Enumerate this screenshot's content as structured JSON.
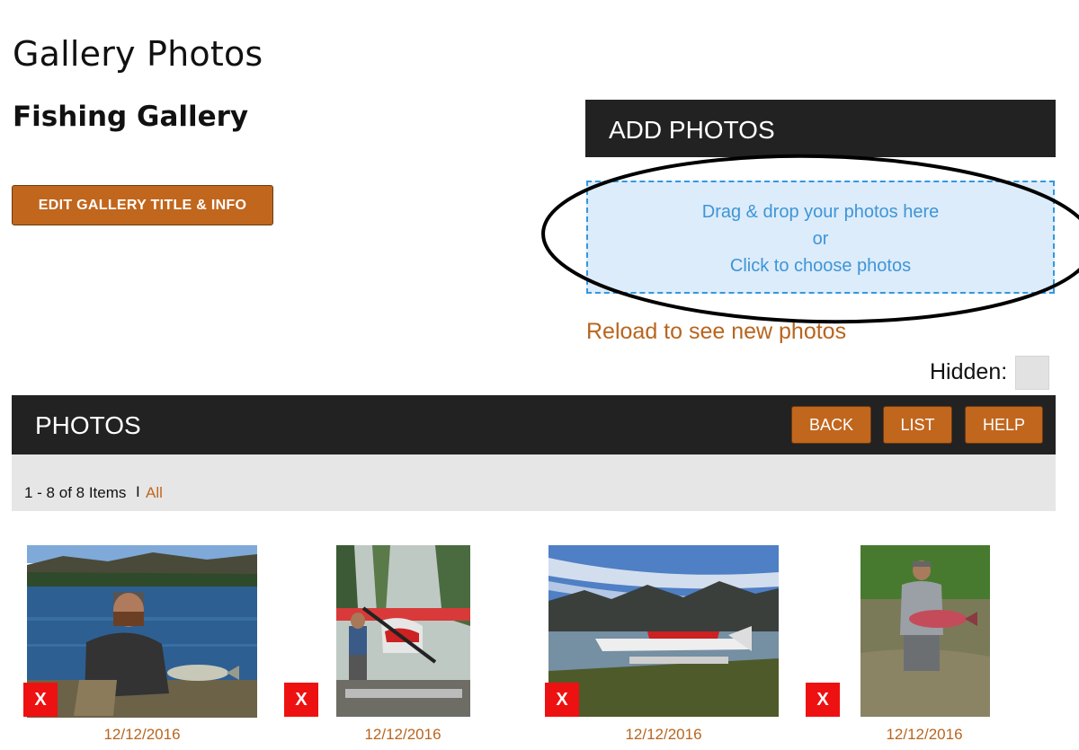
{
  "page": {
    "title": "Gallery Photos",
    "gallery_name": "Fishing Gallery",
    "edit_button": "EDIT GALLERY TITLE & INFO"
  },
  "add_photos": {
    "header": "ADD PHOTOS",
    "drop_line1": "Drag & drop your photos here",
    "drop_line2": "or",
    "drop_line3": "Click to choose photos",
    "reload": "Reload to see new photos"
  },
  "hidden": {
    "label": "Hidden:",
    "checked": false
  },
  "photos": {
    "header": "PHOTOS",
    "buttons": {
      "back": "BACK",
      "list": "LIST",
      "help": "HELP"
    },
    "pager": {
      "count": "1 - 8 of 8 Items",
      "separator": "I",
      "all": "All"
    },
    "items": [
      {
        "delete": "X",
        "date": "12/12/2016"
      },
      {
        "delete": "X",
        "date": "12/12/2016"
      },
      {
        "delete": "X",
        "date": "12/12/2016"
      },
      {
        "delete": "X",
        "date": "12/12/2016"
      }
    ]
  },
  "colors": {
    "accent": "#c1661d",
    "header_bg": "#222222",
    "dropzone_bg": "#dcecfb",
    "dropzone_border": "#3498db",
    "delete_red": "#ee1111"
  }
}
